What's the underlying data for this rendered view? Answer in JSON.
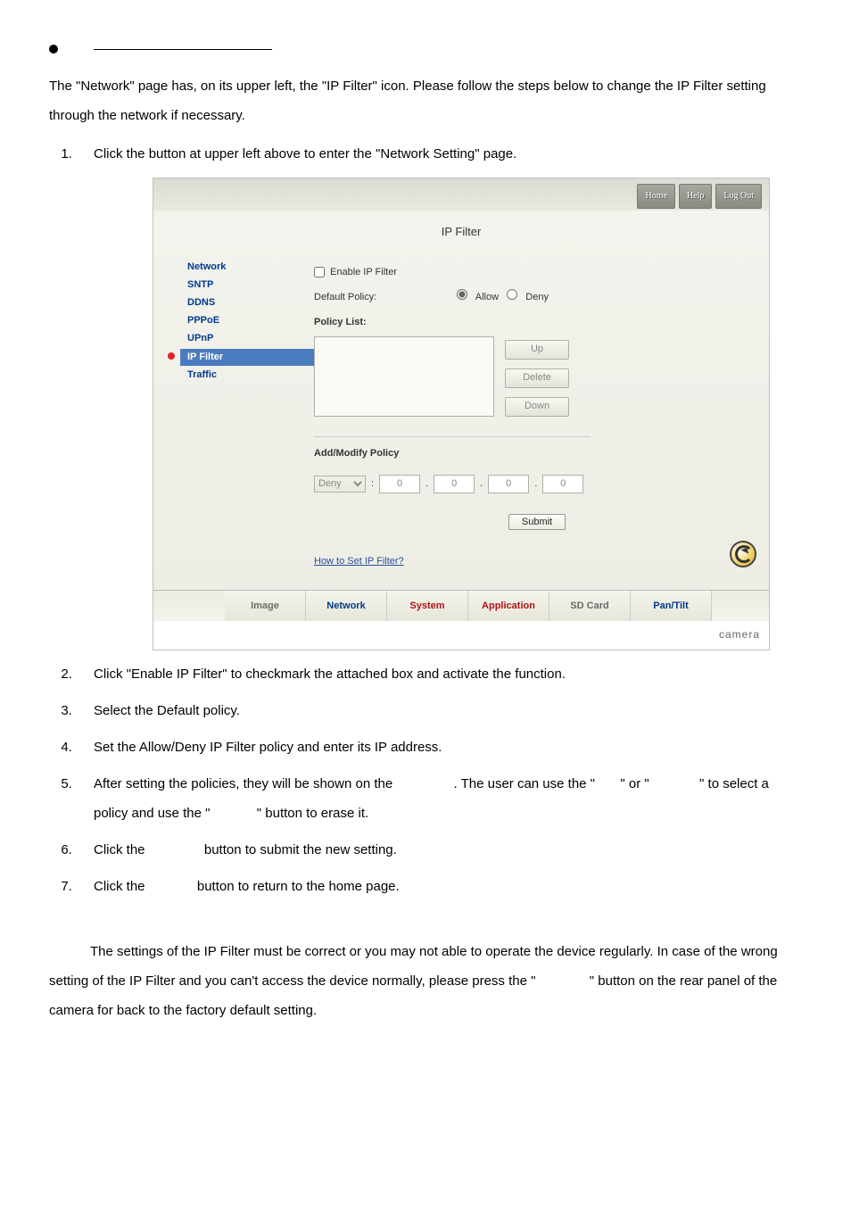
{
  "intro": {
    "para1": "The \"Network\" page has, on its upper left, the \"IP Filter\" icon. Please follow the steps below to change the IP Filter setting through the network if necessary."
  },
  "steps": {
    "s1_a": "Click the ",
    "s1_b": " button at upper left above to enter the \"Network Setting\" page.",
    "s2": "Click \"Enable IP Filter\" to checkmark the attached box and activate the function.",
    "s3": "Select the Default policy.",
    "s4": "Set the Allow/Deny IP Filter policy and enter its IP address.",
    "s5_a": "After setting the policies, they will be shown on the ",
    "s5_b": ". The user can use the \"",
    "s5_c": "\" or \"",
    "s5_d": "\" to select a policy and use the \"",
    "s5_e": "\" button to erase it.",
    "s6_a": "Click the ",
    "s6_b": " button to submit the new setting.",
    "s7_a": "Click the ",
    "s7_b": " button to return to the home page."
  },
  "note": {
    "p1": "The settings of the IP Filter must be correct or you may not able to operate the device regularly. In case of the wrong setting of the IP Filter and you can't access the device normally, please press the \"",
    "p2": "\" button on the rear panel of the camera for back to the factory default setting."
  },
  "shot": {
    "topButtons": {
      "home": "Home",
      "help": "Help",
      "logout": "Log Out"
    },
    "title": "IP Filter",
    "nav": {
      "network": "Network",
      "sntp": "SNTP",
      "ddns": "DDNS",
      "pppoe": "PPPoE",
      "upnp": "UPnP",
      "ipfilter": "IP Filter",
      "traffic": "Traffic"
    },
    "main": {
      "enable_label": "Enable IP Filter",
      "default_policy_label": "Default Policy:",
      "allow_label": "Allow",
      "deny_label": "Deny",
      "policy_list_label": "Policy List:",
      "btn_up": "Up",
      "btn_delete": "Delete",
      "btn_down": "Down",
      "add_modify_label": "Add/Modify Policy",
      "select_deny": "Deny",
      "ip": {
        "a": "0",
        "b": "0",
        "c": "0",
        "d": "0"
      },
      "submit": "Submit",
      "howlink": "How to Set IP Filter?"
    },
    "tabs": {
      "image": "Image",
      "network": "Network",
      "system": "System",
      "application": "Application",
      "sdcard": "SD Card",
      "pantilt": "Pan/Tilt"
    },
    "camera_label": "camera"
  }
}
